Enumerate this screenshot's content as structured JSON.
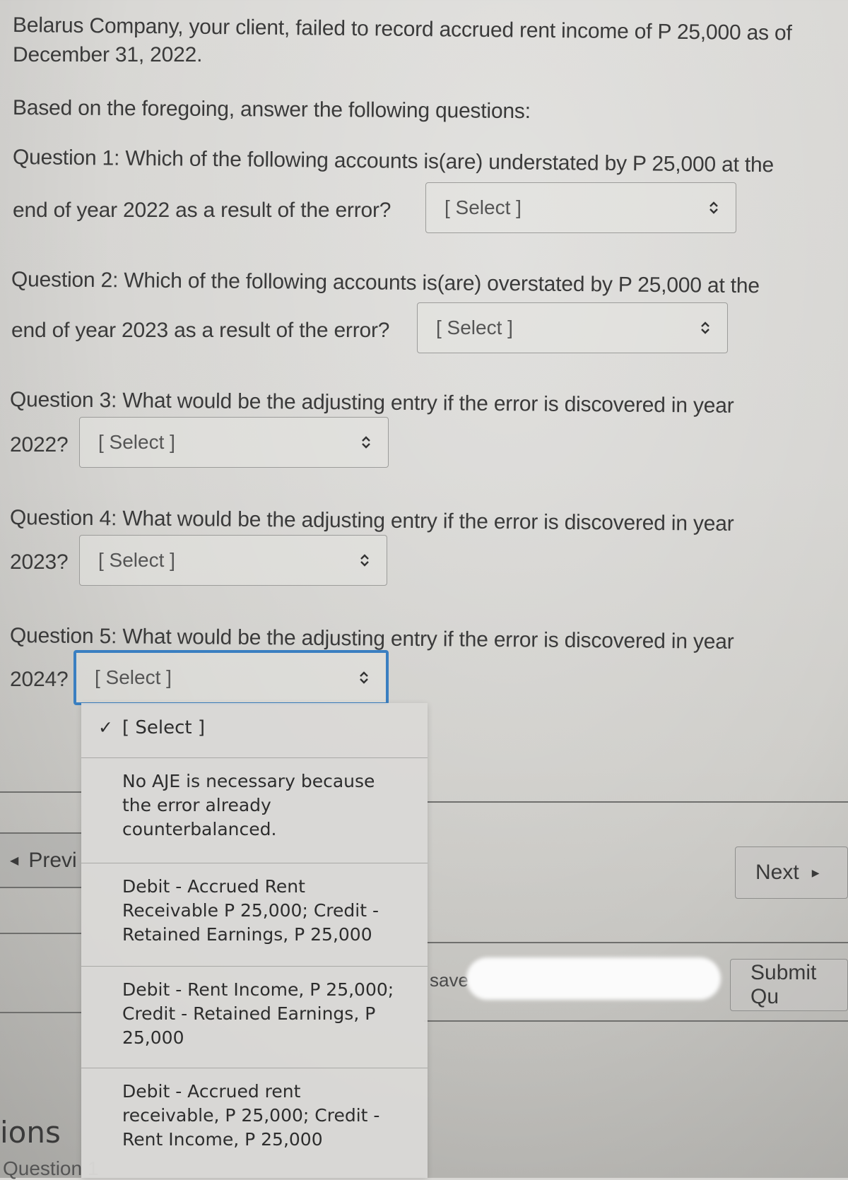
{
  "intro": {
    "line1": "Belarus Company, your client, failed to record accrued rent income of P 25,000 as of",
    "line2": "December 31, 2022.",
    "instruction": "Based on the foregoing, answer the following questions:"
  },
  "questions": [
    {
      "line1": "Question 1: Which of the following accounts is(are) understated by P 25,000 at the",
      "line2": "end of year 2022 as a result of the error?",
      "selected": "[ Select ]"
    },
    {
      "line1": "Question 2: Which of the following accounts is(are) overstated by P 25,000 at the",
      "line2": "end of year 2023 as a result of the error?",
      "selected": "[ Select ]"
    },
    {
      "line1": "Question 3: What would be the adjusting entry if the error is discovered in year",
      "line2": "2022?",
      "selected": "[ Select ]"
    },
    {
      "line1": "Question 4: What would be the adjusting entry if the error is discovered in year",
      "line2": "2023?",
      "selected": "[ Select ]"
    },
    {
      "line1": "Question 5: What would be the adjusting entry if the error is discovered in year",
      "line2": "2024?",
      "selected": "[ Select ]"
    }
  ],
  "dropdown": {
    "check_icon": "✓",
    "options": [
      {
        "label": "[ Select ]",
        "selected": true
      },
      {
        "label": "No AJE is necessary because the error already counterbalanced.",
        "lines": [
          "No AJE is necessary because",
          "the error already",
          "counterbalanced."
        ]
      },
      {
        "label": "Debit - Accrued Rent Receivable P 25,000; Credit - Retained Earnings, P 25,000",
        "lines": [
          "Debit - Accrued Rent",
          "Receivable P 25,000; Credit -",
          "Retained Earnings, P 25,000"
        ]
      },
      {
        "label": "Debit - Rent Income, P 25,000; Credit - Retained Earnings, P 25,000",
        "lines": [
          "Debit - Rent Income, P 25,000;",
          "Credit - Retained Earnings, P",
          "25,000"
        ]
      },
      {
        "label": "Debit - Accrued rent receivable, P 25,000; Credit - Rent Income, P 25,000",
        "lines": [
          "Debit - Accrued rent",
          "receivable, P 25,000; Credit -",
          "Rent Income, P 25,000"
        ]
      }
    ]
  },
  "nav": {
    "previous_label": "Previ",
    "previous_icon": "◀",
    "next_label": "Next",
    "next_icon": "▶",
    "saved_text": "save",
    "submit_label": "Submit Qu"
  },
  "sidebar": {
    "heading_partial": "ions",
    "item_partial": "Question 1"
  },
  "colors": {
    "focus_border": "#3a7fc1",
    "background": "#d6d5d2"
  }
}
